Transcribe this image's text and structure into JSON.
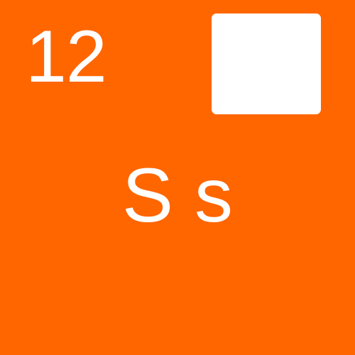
{
  "tile": {
    "number": "12",
    "letters": "S s",
    "background_color": "#ff6600",
    "foreground_color": "#ffffff"
  }
}
